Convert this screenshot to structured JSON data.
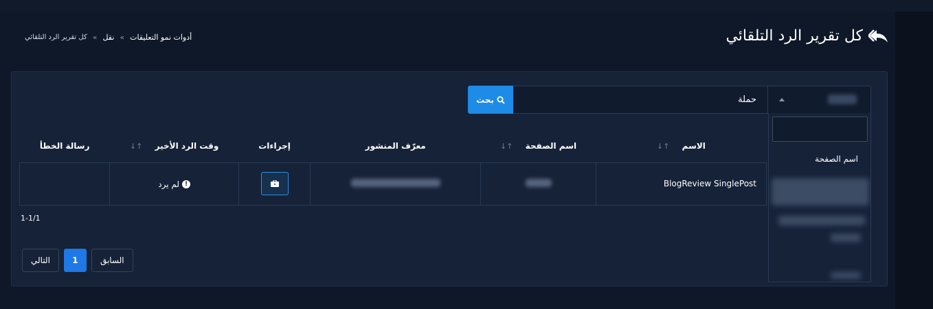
{
  "header": {
    "title": "كل تقرير الرد التلقائي",
    "breadcrumb": {
      "root": "أدوات نمو التعليقات",
      "separator": "»",
      "middle": "نقل",
      "current": "كل تقرير الرد التلقائي"
    }
  },
  "filter": {
    "search_value": "حملة",
    "search_button": "بحث",
    "dropdown_search_placeholder": "",
    "dropdown_option": "اسم الصفحة"
  },
  "table": {
    "columns": {
      "name": "الاسم",
      "page_name": "اسم الصفحة",
      "post_id": "معرّف المنشور",
      "actions": "إجراءات",
      "last_reply": "وقت الرد الأخير",
      "error": "رسالة الخطأ"
    },
    "sort_glyph": "↑↓",
    "rows": [
      {
        "name": "BlogReview SinglePost",
        "last_reply": "لم يرد",
        "error": ""
      }
    ]
  },
  "pagination": {
    "count": "1-1/1",
    "prev": "السابق",
    "current": "1",
    "next": "التالي"
  },
  "colors": {
    "accent": "#1e8be6",
    "background": "#0f1829",
    "card": "#162238"
  }
}
